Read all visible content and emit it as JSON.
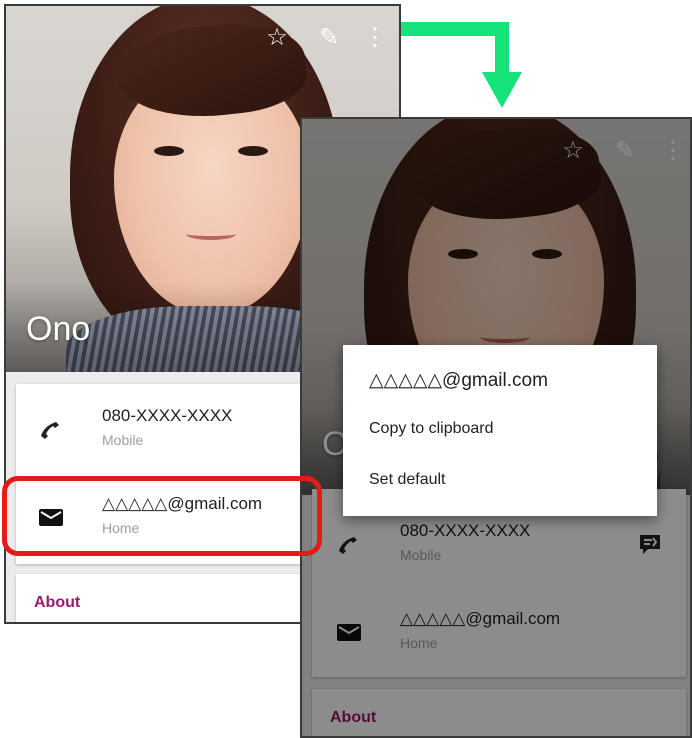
{
  "contact": {
    "name": "Ono",
    "phone": {
      "number": "080-XXXX-XXXX",
      "type": "Mobile"
    },
    "email": {
      "address": "△△△△△@gmail.com",
      "type": "Home"
    },
    "about_label": "About"
  },
  "toolbar": {
    "star_glyph": "☆",
    "edit_glyph": "✎",
    "more_glyph": "⋮"
  },
  "context_menu": {
    "title": "△△△△△@gmail.com",
    "options": [
      "Copy to clipboard",
      "Set default"
    ]
  },
  "colors": {
    "accent_about": "#9c1a6a",
    "highlight": "#e41b1b",
    "arrow": "#14e37a"
  },
  "icons": [
    "star-icon",
    "edit-icon",
    "more-vert-icon",
    "phone-icon",
    "email-icon",
    "message-icon"
  ]
}
